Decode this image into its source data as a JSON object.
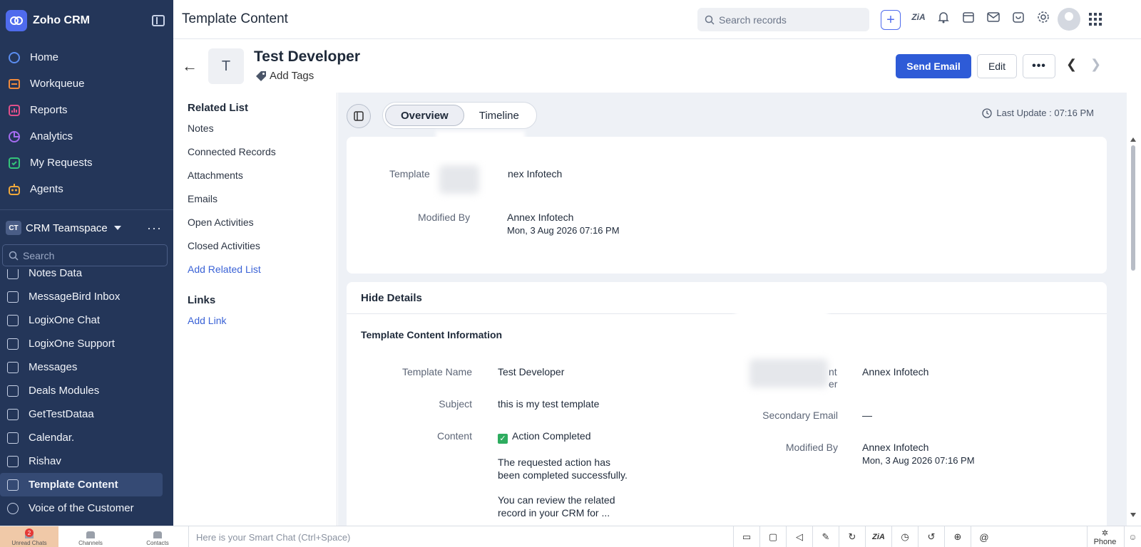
{
  "app": {
    "name": "Zoho CRM"
  },
  "sidebar": {
    "main_nav": [
      {
        "label": "Home",
        "icon": "home-icon",
        "color": "#5b8df0"
      },
      {
        "label": "Workqueue",
        "icon": "workqueue-icon",
        "color": "#f08a3c"
      },
      {
        "label": "Reports",
        "icon": "reports-icon",
        "color": "#e0508a"
      },
      {
        "label": "Analytics",
        "icon": "analytics-icon",
        "color": "#a56cf0"
      },
      {
        "label": "My Requests",
        "icon": "requests-icon",
        "color": "#34c47a"
      },
      {
        "label": "Agents",
        "icon": "agents-icon",
        "color": "#f0a93c"
      }
    ],
    "teamspace": {
      "badge": "CT",
      "name": "CRM Teamspace"
    },
    "search_placeholder": "Search",
    "modules": [
      {
        "label": "Notes Data"
      },
      {
        "label": "MessageBird Inbox"
      },
      {
        "label": "LogixOne Chat"
      },
      {
        "label": "LogixOne Support"
      },
      {
        "label": "Messages"
      },
      {
        "label": "Deals Modules"
      },
      {
        "label": "GetTestDataa"
      },
      {
        "label": "Calendar."
      },
      {
        "label": "Rishav"
      },
      {
        "label": "Template Content",
        "active": true
      },
      {
        "label": "Voice of the Customer"
      }
    ]
  },
  "header": {
    "title": "Template Content",
    "search_placeholder": "Search records"
  },
  "record": {
    "avatar_letter": "T",
    "name": "Test Developer",
    "add_tags": "Add Tags",
    "send_email": "Send Email",
    "edit": "Edit",
    "more": "•••"
  },
  "related": {
    "heading": "Related List",
    "items": [
      "Notes",
      "Connected Records",
      "Attachments",
      "Emails",
      "Open Activities",
      "Closed Activities"
    ],
    "add_related": "Add Related List",
    "links_heading": "Links",
    "add_link": "Add Link"
  },
  "main": {
    "tabs": [
      {
        "label": "Overview",
        "active": true
      },
      {
        "label": "Timeline",
        "active": false
      }
    ],
    "last_update": "Last Update : 07:16 PM",
    "summary": {
      "owner_label": "Template",
      "owner_value": "nex Infotech",
      "modified_label": "Modified By",
      "modified_value": "Annex Infotech",
      "modified_time": "Mon, 3 Aug 2026 07:16 PM"
    },
    "details": {
      "hide_label": "Hide Details",
      "section_title": "Template Content Information",
      "left": {
        "name_label": "Template Name",
        "name_value": "Test Developer",
        "subject_label": "Subject",
        "subject_value": "this is my test template",
        "content_label": "Content",
        "content_status": "Action Completed",
        "content_line1": "The requested action has",
        "content_line2": "been completed successfully.",
        "content_line3": "You can review the related",
        "content_line4": "record in your CRM for ..."
      },
      "right": {
        "owner_label_tail1": "nt",
        "owner_label_tail2": "er",
        "owner_value": "Annex Infotech",
        "secondary_label": "Secondary Email",
        "secondary_value": "—",
        "modified_label": "Modified By",
        "modified_value": "Annex Infotech",
        "modified_time": "Mon, 3 Aug 2026 07:16 PM"
      }
    }
  },
  "bottombar": {
    "unread_chats": "Unread Chats",
    "unread_count": "2",
    "channels": "Channels",
    "contacts": "Contacts",
    "smart_chat": "Here is your Smart Chat (Ctrl+Space)",
    "phone": "Phone"
  },
  "colors": {
    "sidebar_bg": "#243659",
    "primary": "#2e5bd7",
    "link": "#3a62d6",
    "content_bg": "#eef1f6"
  }
}
